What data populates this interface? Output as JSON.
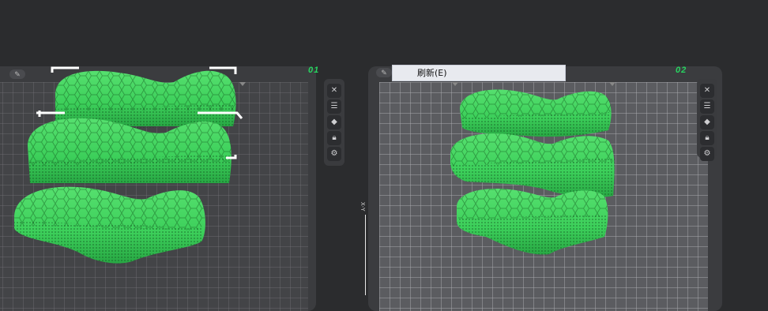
{
  "plates": [
    {
      "number": "01"
    },
    {
      "number": "02"
    }
  ],
  "context_menu": {
    "items": [
      {
        "label": "刷新(E)"
      }
    ]
  },
  "axis_label": "X-Y",
  "toolbar_icons": [
    "close-icon",
    "list-icon",
    "paint-icon",
    "lock-icon",
    "gear-icon"
  ],
  "colors": {
    "model_green": "#3ccf5a",
    "plate_number_green": "#27d460",
    "background": "#2b2c2e"
  }
}
